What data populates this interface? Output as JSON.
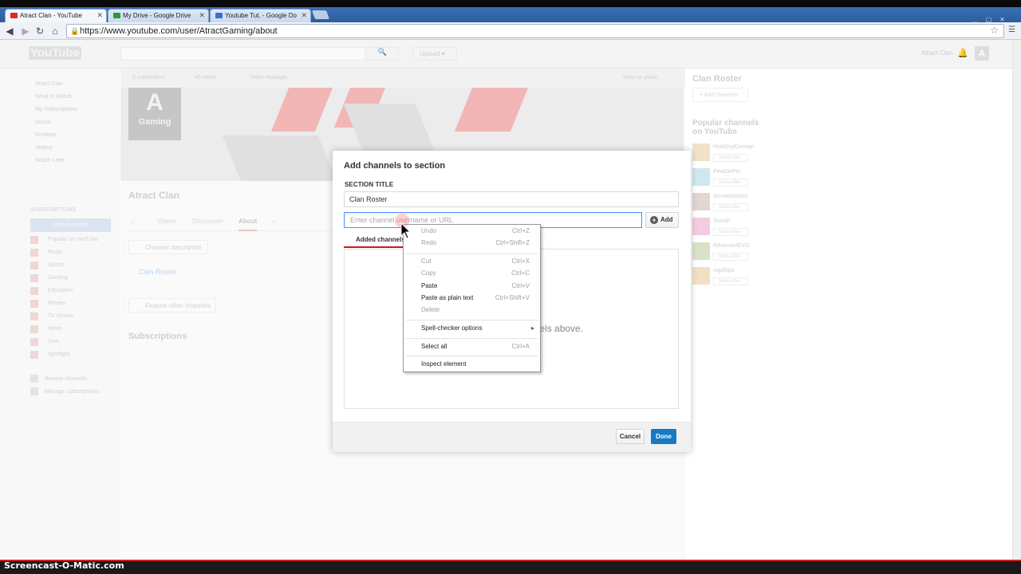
{
  "browser": {
    "tabs": [
      {
        "title": "Atract Clan - YouTube",
        "favicon_color": "#e22"
      },
      {
        "title": "My Drive - Google Drive",
        "favicon_color": "#2a9a3a"
      },
      {
        "title": "Youtube Tut. - Google Do",
        "favicon_color": "#3b6fd8"
      }
    ],
    "url": "https://www.youtube.com/user/AtractGaming/about"
  },
  "youtube": {
    "logo": "YouTube",
    "upload_label": "Upload",
    "user_name": "Atract Clan",
    "avatar_letter": "A",
    "guide": {
      "items": [
        "Atract Clan",
        "What to Watch",
        "My Subscriptions",
        "Social",
        "Reviews",
        "History",
        "Watch Later"
      ],
      "subscriptions_title": "SUBSCRIPTIONS",
      "add_channels": "Add channels",
      "subscriptions": [
        "Popular on YouTube",
        "Music",
        "Sports",
        "Gaming",
        "Education",
        "Movies",
        "TV Shows",
        "News",
        "Live",
        "Spotlight"
      ],
      "bottom": [
        "Browse channels",
        "Manage subscriptions"
      ]
    },
    "channel": {
      "stats": [
        "3 subscribers",
        "46 views",
        "Video Manager"
      ],
      "view_as_public": "View as public",
      "avatar_big": "A",
      "avatar_small": "Gaming",
      "title": "Atract Clan",
      "tabs": [
        "Videos",
        "Discussion",
        "About"
      ],
      "channel_description": "Channel description",
      "clan_roster_link": "Clan Roster",
      "feature_other": "Feature other channels",
      "subscriptions_title": "Subscriptions"
    },
    "right": {
      "roster_title": "Clan Roster",
      "roster_add": "+ Add channels",
      "popular_title": "Popular channels on YouTube",
      "popular": [
        {
          "name": "HolaSoyGerman",
          "sub": "Subscribe",
          "color": "#efe2c8"
        },
        {
          "name": "PewDiePie",
          "sub": "Subscribe",
          "color": "#cfe7ee"
        },
        {
          "name": "JennaMarbles",
          "sub": "Subscribe",
          "color": "#e2d6d2"
        },
        {
          "name": "Smosh",
          "sub": "Subscribe",
          "color": "#f2cce0"
        },
        {
          "name": "RihannaVEVO",
          "sub": "Subscribe",
          "color": "#d9e2c9"
        },
        {
          "name": "nigahiga",
          "sub": "Subscribe",
          "color": "#f2e0c6"
        }
      ]
    }
  },
  "modal": {
    "title": "Add channels to section",
    "section_label": "SECTION TITLE",
    "section_value": "Clan Roster",
    "channel_placeholder": "Enter channel username or URL",
    "add_label": "Add",
    "added_tab": "Added channels",
    "empty_msg": "nnels above.",
    "cancel": "Cancel",
    "done": "Done"
  },
  "context_menu": [
    {
      "label": "Undo",
      "shortcut": "Ctrl+Z",
      "disabled": true
    },
    {
      "label": "Redo",
      "shortcut": "Ctrl+Shift+Z",
      "disabled": true
    },
    {
      "label": "Cut",
      "shortcut": "Ctrl+X",
      "disabled": true
    },
    {
      "label": "Copy",
      "shortcut": "Ctrl+C",
      "disabled": true
    },
    {
      "label": "Paste",
      "shortcut": "Ctrl+V",
      "disabled": false
    },
    {
      "label": "Paste as plain text",
      "shortcut": "Ctrl+Shift+V",
      "disabled": false
    },
    {
      "label": "Delete",
      "shortcut": "",
      "disabled": true
    },
    {
      "label": "Spell-checker options",
      "shortcut": "",
      "disabled": false
    },
    {
      "label": "Select all",
      "shortcut": "Ctrl+A",
      "disabled": false
    },
    {
      "label": "Inspect element",
      "shortcut": "",
      "disabled": false
    }
  ],
  "watermark": "Screencast-O-Matic.com",
  "colors": {
    "accent": "#167ac6",
    "youtube_red": "#cc181e",
    "focus": "#4d90fe"
  }
}
